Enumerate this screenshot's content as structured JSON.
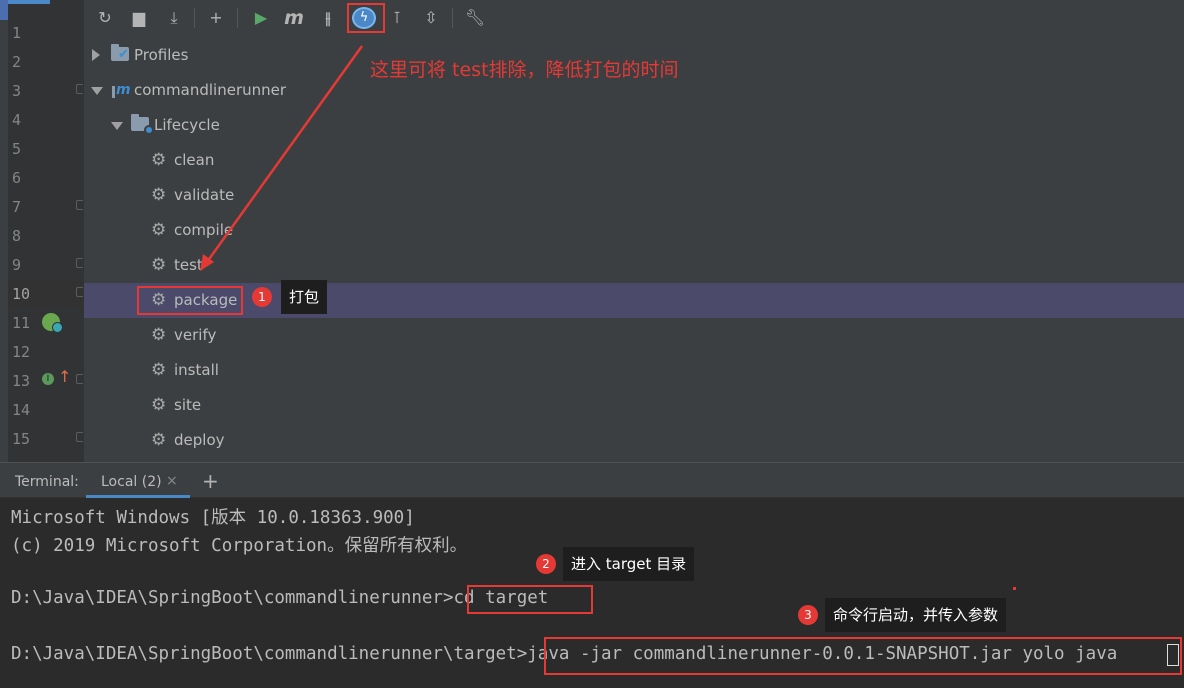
{
  "gutter": {
    "line_numbers": [
      "1",
      "2",
      "3",
      "4",
      "5",
      "6",
      "7",
      "8",
      "9",
      "10",
      "11",
      "12",
      "13",
      "14",
      "15"
    ],
    "current_line": "10"
  },
  "maven": {
    "toolbar": {
      "buttons": [
        "reload-icon",
        "generate-sources-icon",
        "download-icon",
        "add-icon",
        "run-icon",
        "maven-goal-icon",
        "toggle-offline-icon",
        "skip-tests-icon",
        "show-dependencies-icon",
        "collapse-all-icon",
        "settings-wrench-icon"
      ]
    },
    "tree": {
      "profiles": "Profiles",
      "project": "commandlinerunner",
      "lifecycle": "Lifecycle",
      "phases": [
        "clean",
        "validate",
        "compile",
        "test",
        "package",
        "verify",
        "install",
        "site",
        "deploy"
      ],
      "selected_phase": "package"
    }
  },
  "annotations": {
    "skip_test_note": "这里可将 test排除，降低打包的时间",
    "step1_badge": "1",
    "step1_text": "打包",
    "step2_badge": "2",
    "step2_text": "进入 target 目录",
    "step3_badge": "3",
    "step3_text": "命令行启动，并传入参数"
  },
  "terminal": {
    "title": "Terminal:",
    "tab_label": "Local (2)",
    "tab_close": "×",
    "new_tab": "+",
    "lines": [
      "Microsoft Windows [版本 10.0.18363.900]",
      "(c) 2019 Microsoft Corporation。保留所有权利。",
      "",
      "D:\\Java\\IDEA\\SpringBoot\\commandlinerunner>cd target",
      "",
      "D:\\Java\\IDEA\\SpringBoot\\commandlinerunner\\target>java -jar commandlinerunner-0.0.1-SNAPSHOT.jar yolo java"
    ]
  },
  "colors": {
    "accent_red": "#e53935",
    "selection": "#4b4a6b",
    "panel_bg": "#3c3f41",
    "editor_bg": "#2b2b2b"
  }
}
